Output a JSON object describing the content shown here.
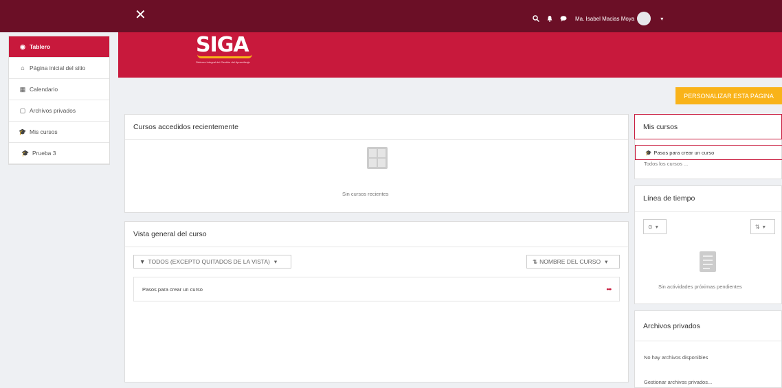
{
  "topbar": {
    "close_label": "✕",
    "search_icon": "search-icon",
    "bell_icon": "bell-icon",
    "chat_icon": "chat-icon",
    "user_name": "Ma. Isabel Macias Moya",
    "caret": "▾"
  },
  "sidebar": {
    "items": [
      {
        "label": "Tablero",
        "icon": "dashboard-icon",
        "glyph": "◉"
      },
      {
        "label": "Página inicial del sitio",
        "icon": "home-icon",
        "glyph": "⌂"
      },
      {
        "label": "Calendario",
        "icon": "calendar-icon",
        "glyph": "▦"
      },
      {
        "label": "Archivos privados",
        "icon": "file-icon",
        "glyph": "▢"
      },
      {
        "label": "Mis cursos",
        "icon": "graduation-cap-icon",
        "glyph": "🎓"
      },
      {
        "label": "Prueba 3",
        "icon": "graduation-cap-icon",
        "glyph": "🎓"
      }
    ]
  },
  "logo": {
    "text": "SIGA",
    "tagline": "Sistema Integral del Gestión del Aprendizaje"
  },
  "customize_button": "PERSONALIZAR ESTA PÁGINA",
  "recent": {
    "title": "Cursos accedidos recientemente",
    "empty_text": "Sin cursos recientes"
  },
  "overview": {
    "title": "Vista general del curso",
    "filter_label": "TODOS (EXCEPTO QUITADOS DE LA VISTA)",
    "sort_label": "NOMBRE DEL CURSO",
    "course_name": "Pasos para crear un curso",
    "more_label": "•••"
  },
  "mis_cursos": {
    "title": "Mis cursos",
    "course_link": "Pasos para crear un curso",
    "all_courses": "Todos los cursos ..."
  },
  "timeline": {
    "title": "Línea de tiempo",
    "empty_text": "Sin actividades próximas pendientes"
  },
  "archivos": {
    "title": "Archivos privados",
    "empty_text": "No hay archivos disponibles",
    "manage_link": "Gestionar archivos privados..."
  },
  "colors": {
    "topbar": "#6b0f26",
    "brand_red": "#c8193c",
    "accent_yellow": "#f9b319"
  }
}
